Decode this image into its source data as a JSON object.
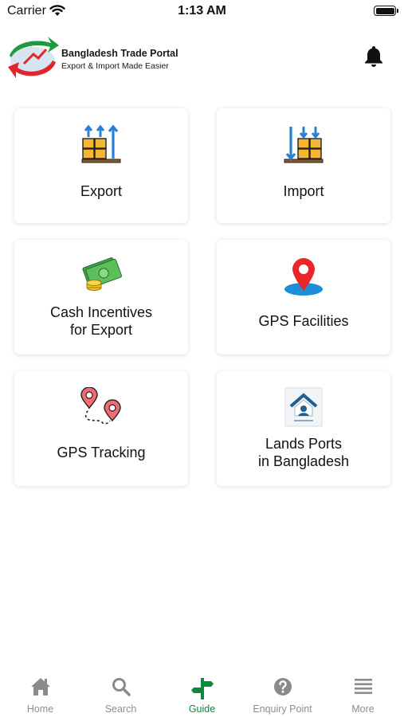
{
  "status_bar": {
    "carrier": "Carrier",
    "time": "1:13 AM"
  },
  "header": {
    "brand_title": "Bangladesh Trade Portal",
    "brand_tagline": "Export & Import Made Easier",
    "bell_icon": "bell-icon"
  },
  "grid": {
    "items": [
      {
        "label": "Export",
        "icon": "export-pallet-icon"
      },
      {
        "label": "Import",
        "icon": "import-pallet-icon"
      },
      {
        "label_line1": "Cash Incentives",
        "label_line2": "for Export",
        "icon": "cash-icon"
      },
      {
        "label": "GPS Facilities",
        "icon": "map-pin-icon"
      },
      {
        "label": "GPS Tracking",
        "icon": "route-pins-icon"
      },
      {
        "label_line1": "Lands Ports",
        "label_line2": "in Bangladesh",
        "icon": "land-port-logo-icon"
      }
    ]
  },
  "tab_bar": {
    "active": "Guide",
    "active_color": "#0f8a3d",
    "inactive_color": "#8e8e8e",
    "tabs": [
      {
        "label": "Home",
        "icon": "home-icon"
      },
      {
        "label": "Search",
        "icon": "search-icon"
      },
      {
        "label": "Guide",
        "icon": "signpost-icon"
      },
      {
        "label": "Enquiry Point",
        "icon": "help-circle-icon"
      },
      {
        "label": "More",
        "icon": "menu-icon"
      }
    ]
  }
}
